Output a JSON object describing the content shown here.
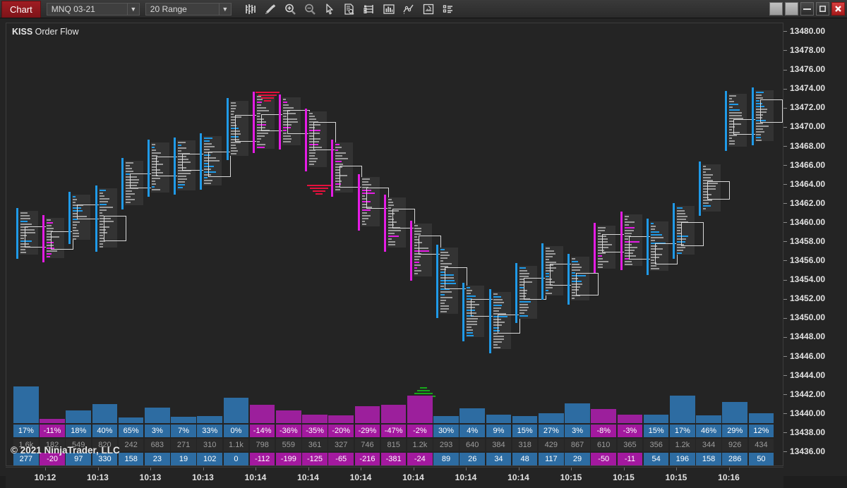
{
  "window": {
    "tab_label": "Chart",
    "controls": [
      {
        "name": "restore-left-button",
        "glyph": ""
      },
      {
        "name": "restore-right-button",
        "glyph": ""
      },
      {
        "name": "minimize-button",
        "glyph": "–"
      },
      {
        "name": "maximize-button",
        "glyph": "☐"
      },
      {
        "name": "close-button",
        "glyph": "✕"
      }
    ]
  },
  "toolbar": {
    "instrument": {
      "value": "MNQ 03-21",
      "arrow": "▼"
    },
    "period": {
      "value": "20 Range",
      "arrow": "▼"
    },
    "icons": [
      "bar-chart-type-icon",
      "drawing-tools-icon",
      "zoom-in-icon",
      "zoom-out-icon",
      "cursor-pointer-icon",
      "data-box-icon",
      "chart-trader-icon",
      "indicators-icon",
      "strategies-icon",
      "snapshot-icon",
      "properties-list-icon"
    ]
  },
  "chart": {
    "title_bold": "KISS",
    "title_rest": " Order Flow",
    "watermark": "© 2021 NinjaTrader, LLC"
  },
  "chart_data": {
    "type": "bar",
    "title": "KISS Order Flow",
    "xlabel": "",
    "ylabel": "Price",
    "ylim": [
      13435.0,
      13481.0
    ],
    "price_ticks": [
      "13480.00",
      "13478.00",
      "13476.00",
      "13474.00",
      "13472.00",
      "13470.00",
      "13468.00",
      "13466.00",
      "13464.00",
      "13462.00",
      "13460.00",
      "13458.00",
      "13456.00",
      "13454.00",
      "13452.00",
      "13450.00",
      "13448.00",
      "13446.00",
      "13444.00",
      "13442.00",
      "13440.00",
      "13438.00",
      "13436.00"
    ],
    "time_ticks": [
      "10:12",
      "10:13",
      "10:13",
      "10:13",
      "10:14",
      "10:14",
      "10:14",
      "10:14",
      "10:14",
      "10:14",
      "10:15",
      "10:15",
      "10:15",
      "10:16"
    ],
    "columns": [
      {
        "pct": "17%",
        "volume": "1.6k",
        "delta": "277",
        "dir": "up"
      },
      {
        "pct": "-11%",
        "volume": "182",
        "delta": "-20",
        "dir": "dn"
      },
      {
        "pct": "18%",
        "volume": "549",
        "delta": "97",
        "dir": "up"
      },
      {
        "pct": "40%",
        "volume": "820",
        "delta": "330",
        "dir": "up"
      },
      {
        "pct": "65%",
        "volume": "242",
        "delta": "158",
        "dir": "up"
      },
      {
        "pct": "3%",
        "volume": "683",
        "delta": "23",
        "dir": "up"
      },
      {
        "pct": "7%",
        "volume": "271",
        "delta": "19",
        "dir": "up"
      },
      {
        "pct": "33%",
        "volume": "310",
        "delta": "102",
        "dir": "up"
      },
      {
        "pct": "0%",
        "volume": "1.1k",
        "delta": "0",
        "dir": "up"
      },
      {
        "pct": "-14%",
        "volume": "798",
        "delta": "-112",
        "dir": "dn"
      },
      {
        "pct": "-36%",
        "volume": "559",
        "delta": "-199",
        "dir": "dn"
      },
      {
        "pct": "-35%",
        "volume": "361",
        "delta": "-125",
        "dir": "dn"
      },
      {
        "pct": "-20%",
        "volume": "327",
        "delta": "-65",
        "dir": "dn"
      },
      {
        "pct": "-29%",
        "volume": "746",
        "delta": "-216",
        "dir": "dn"
      },
      {
        "pct": "-47%",
        "volume": "815",
        "delta": "-381",
        "dir": "dn"
      },
      {
        "pct": "-2%",
        "volume": "1.2k",
        "delta": "-24",
        "dir": "dn"
      },
      {
        "pct": "30%",
        "volume": "293",
        "delta": "89",
        "dir": "up"
      },
      {
        "pct": "4%",
        "volume": "640",
        "delta": "26",
        "dir": "up"
      },
      {
        "pct": "9%",
        "volume": "384",
        "delta": "34",
        "dir": "up"
      },
      {
        "pct": "15%",
        "volume": "318",
        "delta": "48",
        "dir": "up"
      },
      {
        "pct": "27%",
        "volume": "429",
        "delta": "117",
        "dir": "up"
      },
      {
        "pct": "3%",
        "volume": "867",
        "delta": "29",
        "dir": "up"
      },
      {
        "pct": "-8%",
        "volume": "610",
        "delta": "-50",
        "dir": "dn"
      },
      {
        "pct": "-3%",
        "volume": "365",
        "delta": "-11",
        "dir": "dn"
      },
      {
        "pct": "15%",
        "volume": "356",
        "delta": "54",
        "dir": "up"
      },
      {
        "pct": "17%",
        "volume": "1.2k",
        "delta": "196",
        "dir": "up"
      },
      {
        "pct": "46%",
        "volume": "344",
        "delta": "158",
        "dir": "up"
      },
      {
        "pct": "29%",
        "volume": "926",
        "delta": "286",
        "dir": "up"
      },
      {
        "pct": "12%",
        "volume": "434",
        "delta": "50",
        "dir": "up"
      }
    ],
    "signals": [
      {
        "type": "BUY",
        "label": "BUY",
        "x": 591,
        "y": 516
      },
      {
        "type": "SELL",
        "label": "",
        "x": 370,
        "y": 97
      },
      {
        "type": "SELL",
        "label": "",
        "x": 443,
        "y": 229
      }
    ]
  },
  "colors": {
    "up": "#2d6ca2",
    "down": "#9c1f9c",
    "bid": "#1f9ae8",
    "ask": "#e41ce4",
    "buy_signal": "#17a81a",
    "sell_signal": "#e5103c",
    "background": "#242424",
    "accent_tab": "#a01c22"
  }
}
